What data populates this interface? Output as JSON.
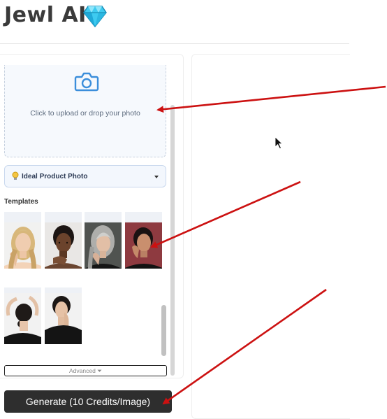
{
  "app": {
    "title": "Jewl AI",
    "gem_icon": "gem-icon"
  },
  "upload": {
    "icon": "camera-icon",
    "text": "Click to upload or drop your photo"
  },
  "dropdown": {
    "icon": "lightbulb-icon",
    "selected": "Ideal Product Photo"
  },
  "templates": {
    "label": "Templates",
    "items": [
      {
        "name": "template-blonde-woman"
      },
      {
        "name": "template-dark-skin-woman"
      },
      {
        "name": "template-grey-hair-woman"
      },
      {
        "name": "template-woman-red-background"
      },
      {
        "name": "template-woman-arms-raised"
      },
      {
        "name": "template-woman-hand-on-neck"
      }
    ]
  },
  "advanced": {
    "label": "Advanced ⏷"
  },
  "generate": {
    "label": "Generate (10 Credits/Image)"
  },
  "colors": {
    "accent": "#3b8edb",
    "arrow": "#cc1111",
    "button": "#2e2e2e"
  }
}
